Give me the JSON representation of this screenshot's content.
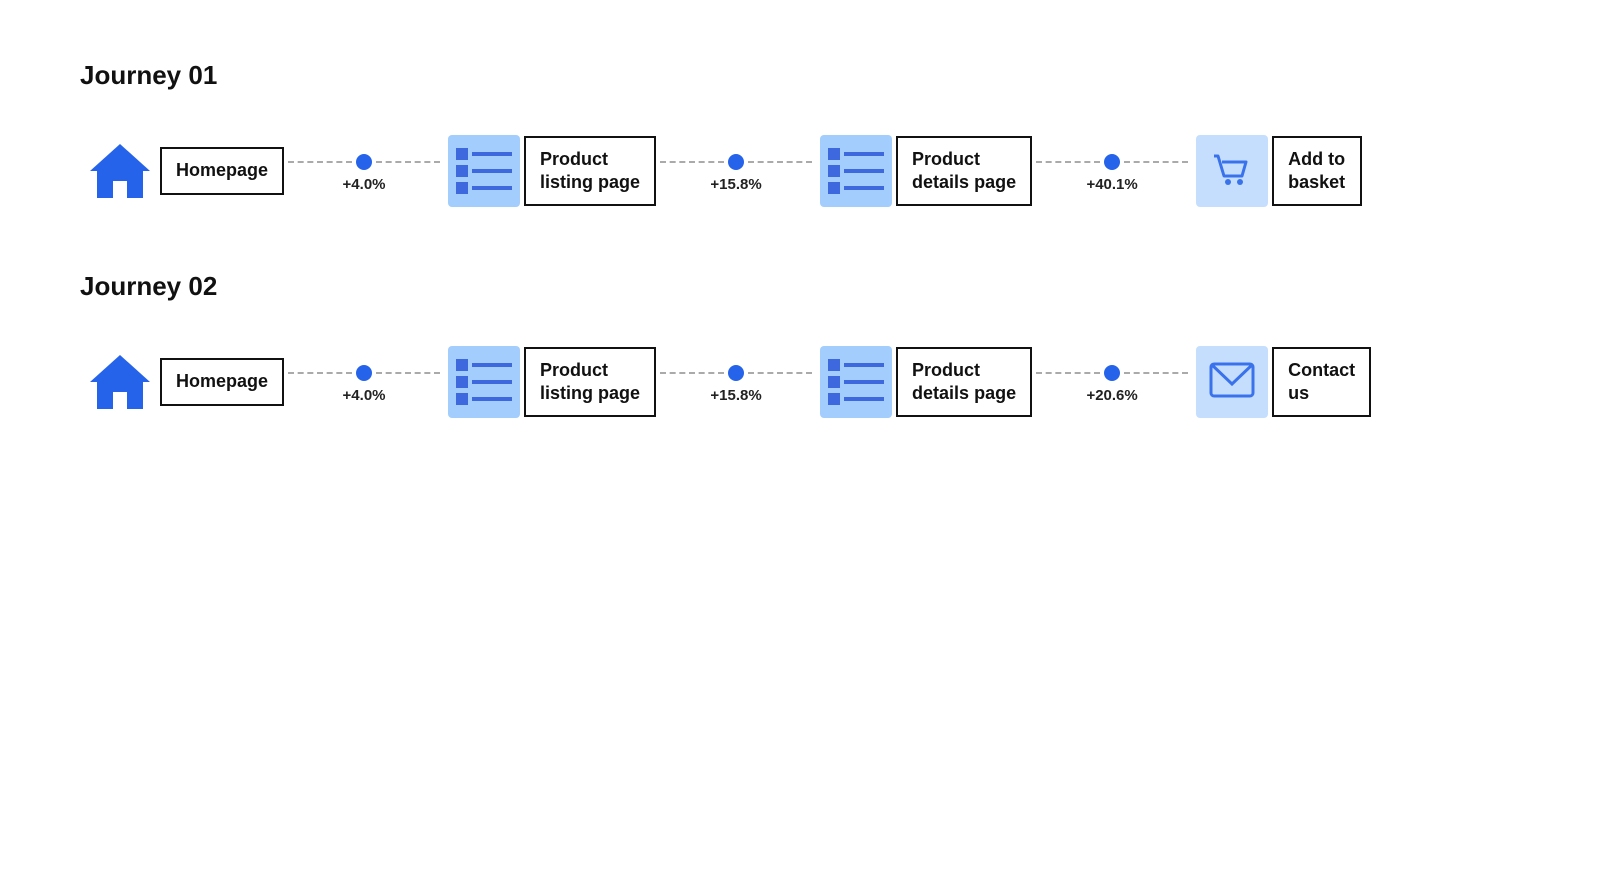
{
  "journey1": {
    "title": "Journey 01",
    "nodes": [
      {
        "id": "home",
        "icon": "home",
        "label": "Homepage"
      },
      {
        "connector": "+4.0%"
      },
      {
        "id": "product-listing",
        "icon": "list",
        "label": "Product\nlisting page"
      },
      {
        "connector": "+15.8%"
      },
      {
        "id": "product-details",
        "icon": "list",
        "label": "Product\ndetails page"
      },
      {
        "connector": "+40.1%"
      },
      {
        "id": "add-to-basket",
        "icon": "cart",
        "label": "Add to\nbasket"
      }
    ]
  },
  "journey2": {
    "title": "Journey 02",
    "nodes": [
      {
        "id": "home",
        "icon": "home",
        "label": "Homepage"
      },
      {
        "connector": "+4.0%"
      },
      {
        "id": "product-listing",
        "icon": "list",
        "label": "Product\nlisting page"
      },
      {
        "connector": "+15.8%"
      },
      {
        "id": "product-details",
        "icon": "list",
        "label": "Product\ndetails page"
      },
      {
        "connector": "+20.6%"
      },
      {
        "id": "contact-us",
        "icon": "mail",
        "label": "Contact\nus"
      }
    ]
  }
}
